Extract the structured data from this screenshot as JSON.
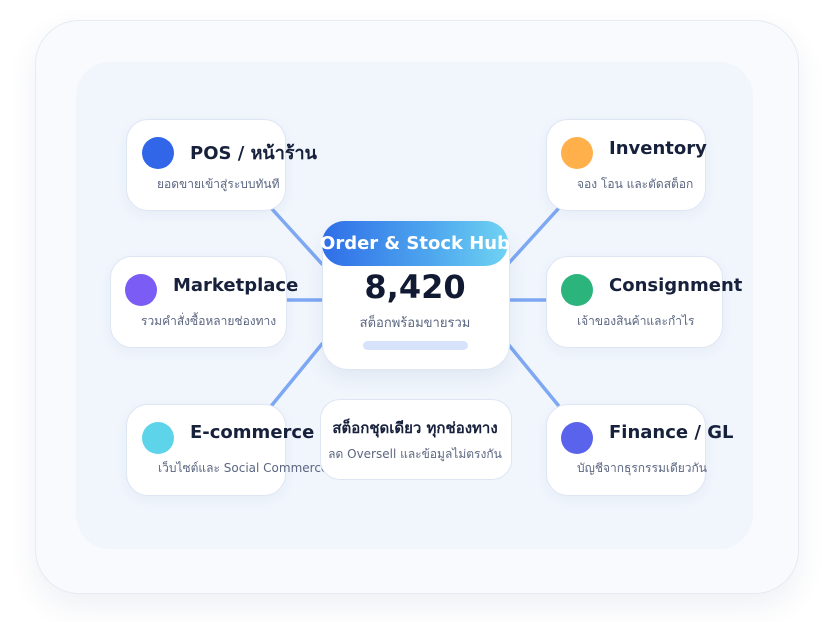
{
  "hub": {
    "title": "Order & Stock Hub",
    "value": "8,420",
    "subtitle": "สต็อกพร้อมขายรวม"
  },
  "nodes": [
    {
      "title": "POS / หน้าร้าน",
      "subtitle": "ยอดขายเข้าสู่ระบบทันที",
      "color": "#3266e9",
      "dot_icon": "circle"
    },
    {
      "title": "Marketplace",
      "subtitle": "รวมคำสั่งซื้อหลายช่องทาง",
      "color": "#7b5cf5",
      "dot_icon": "circle"
    },
    {
      "title": "E-commerce",
      "subtitle": "เว็บไซต์และ Social Commerce",
      "color": "#5dd4ea",
      "dot_icon": "circle"
    },
    {
      "title": "Inventory",
      "subtitle": "จอง โอน และตัดสต็อก",
      "color": "#ffb04a",
      "dot_icon": "circle"
    },
    {
      "title": "Consignment",
      "subtitle": "เจ้าของสินค้าและกำไร",
      "color": "#2bb57c",
      "dot_icon": "circle"
    },
    {
      "title": "Finance / GL",
      "subtitle": "บัญชีจากธุรกรรมเดียวกัน",
      "color": "#5a63ec",
      "dot_icon": "circle"
    }
  ],
  "note": {
    "title": "สต็อกชุดเดียว ทุกช่องทาง",
    "subtitle": "ลด Oversell และข้อมูลไม่ตรงกัน"
  },
  "colors": {
    "connector": "#7ea8f3",
    "hub_gradient_start": "#2f6ee8",
    "hub_gradient_end": "#6fd3f2"
  }
}
